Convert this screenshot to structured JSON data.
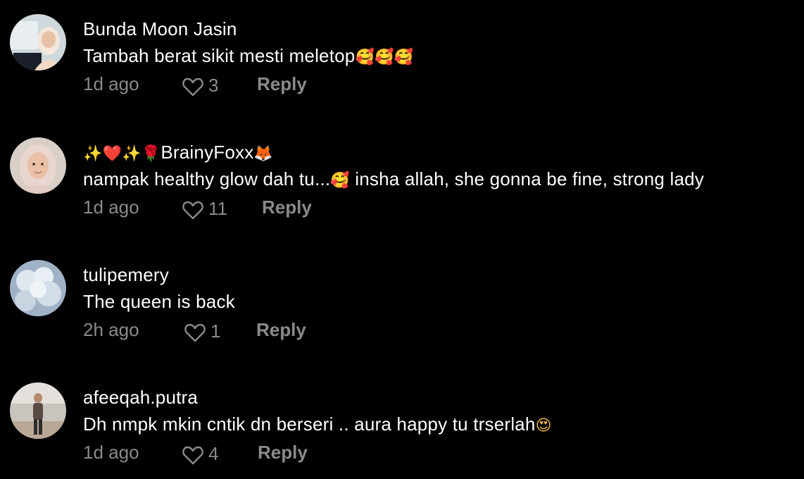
{
  "comments": [
    {
      "username": "Bunda Moon Jasin",
      "text": "Tambah berat sikit mesti meletop",
      "text_emoji": "🥰🥰🥰",
      "time": "1d ago",
      "likes": "3",
      "reply": "Reply"
    },
    {
      "username_prefix": "✨❤️✨🌹",
      "username": "BrainyFoxx",
      "username_suffix": "🦊",
      "text": "nampak healthy glow dah tu...",
      "text_emoji": "🥰",
      "text_after": " insha allah, she gonna be fine, strong lady",
      "time": "1d ago",
      "likes": "11",
      "reply": "Reply"
    },
    {
      "username": "tulipemery",
      "text": "The queen is back",
      "time": "2h ago",
      "likes": "1",
      "reply": "Reply"
    },
    {
      "username": "afeeqah.putra",
      "text": "Dh nmpk mkin cntik dn berseri .. aura happy tu trserlah",
      "text_emoji": "😍",
      "time": "1d ago",
      "likes": "4",
      "reply": "Reply"
    }
  ],
  "colors": {
    "background": "#000000",
    "primary_text": "#ffffff",
    "secondary_text": "#8a8a8a"
  }
}
